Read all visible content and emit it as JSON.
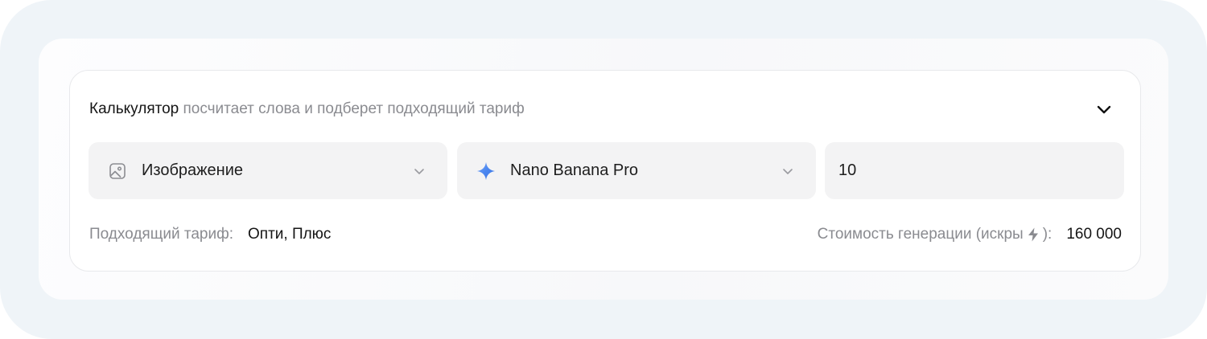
{
  "calculator": {
    "title": "Калькулятор",
    "subtitle": " посчитает слова и подберет подходящий тариф",
    "collapse_icon": "chevron-up-down-icon"
  },
  "type_select": {
    "icon": "image-icon",
    "value": "Изображение",
    "chevron_icon": "chevron-down-icon"
  },
  "model_select": {
    "icon": "sparkle-icon",
    "value": "Nano Banana Pro",
    "chevron_icon": "chevron-down-icon"
  },
  "count_input": {
    "value": "10"
  },
  "result": {
    "tariff_label": "Подходящий тариф:",
    "tariff_value": "Опти, Плюс",
    "cost_label_before": "Стоимость генерации (искры",
    "cost_label_after": "):",
    "cost_value": "160 000",
    "bolt_icon": "lightning-icon"
  },
  "colors": {
    "outer_bg": "#eff4f8",
    "field_bg": "#f3f3f4",
    "muted_text": "#8a8b90"
  }
}
